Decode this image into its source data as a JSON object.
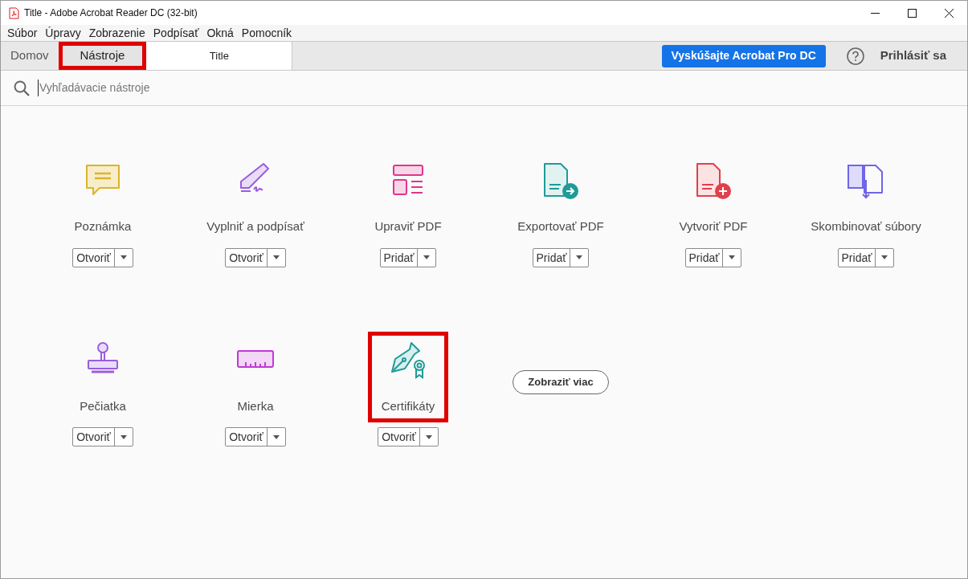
{
  "window": {
    "title": "Title - Adobe Acrobat Reader DC (32-bit)"
  },
  "menu": [
    "Súbor",
    "Úpravy",
    "Zobrazenie",
    "Podpísať",
    "Okná",
    "Pomocník"
  ],
  "tabs": [
    {
      "label": "Domov",
      "kind": "nav",
      "selected": false,
      "highlighted": false
    },
    {
      "label": "Nástroje",
      "kind": "nav",
      "selected": true,
      "highlighted": true
    },
    {
      "label": "Title",
      "kind": "document",
      "selected": false,
      "highlighted": false
    }
  ],
  "trial_button": "Vyskúšajte Acrobat Pro DC",
  "sign_in": "Prihlásiť sa",
  "search": {
    "placeholder": "Vyhľadávacie nástroje"
  },
  "tools": [
    {
      "kind": "comment",
      "label": "Poznámka",
      "action": "Otvoriť",
      "highlighted": false
    },
    {
      "kind": "sign",
      "label": "Vyplniť a podpísať",
      "action": "Otvoriť",
      "highlighted": false
    },
    {
      "kind": "edit",
      "label": "Upraviť PDF",
      "action": "Pridať",
      "highlighted": false
    },
    {
      "kind": "export",
      "label": "Exportovať PDF",
      "action": "Pridať",
      "highlighted": false
    },
    {
      "kind": "create",
      "label": "Vytvoriť PDF",
      "action": "Pridať",
      "highlighted": false
    },
    {
      "kind": "combine",
      "label": "Skombinovať súbory",
      "action": "Pridať",
      "highlighted": false
    },
    {
      "kind": "stamp",
      "label": "Pečiatka",
      "action": "Otvoriť",
      "highlighted": false
    },
    {
      "kind": "measure",
      "label": "Mierka",
      "action": "Otvoriť",
      "highlighted": false
    },
    {
      "kind": "certificate",
      "label": "Certifikáty",
      "action": "Otvoriť",
      "highlighted": true
    }
  ],
  "more_button": "Zobraziť viac"
}
